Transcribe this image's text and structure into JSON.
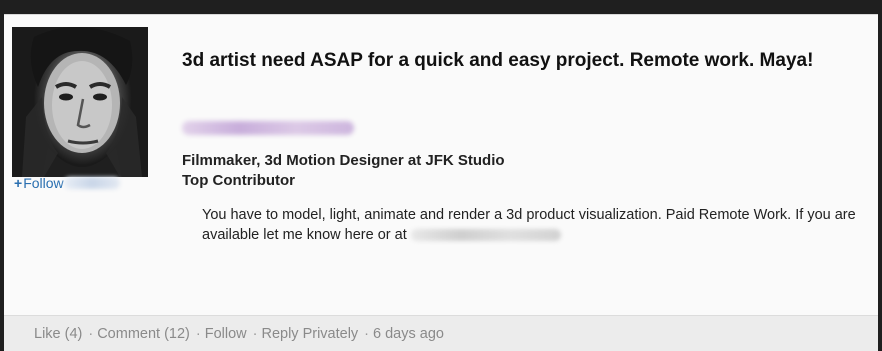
{
  "post": {
    "title": "3d artist need ASAP for a quick and easy project. Remote work. Maya!",
    "author_headline": "Filmmaker, 3d Motion Designer at JFK Studio",
    "author_badge": "Top Contributor",
    "body_text": "You have to model, light, animate and render a 3d product visualization. Paid Remote Work. If you are available let me know here or at"
  },
  "profile": {
    "follow_plus": "+",
    "follow_label": "Follow"
  },
  "footer": {
    "like": "Like (4)",
    "comment": "Comment (12)",
    "follow": "Follow",
    "reply_privately": "Reply Privately",
    "time_ago": "6 days ago",
    "separator": "·"
  },
  "colors": {
    "link": "#2a6fb0",
    "footer_text": "#8a8a8a",
    "card_bg": "#fafafa",
    "footer_bg": "#ececec"
  }
}
